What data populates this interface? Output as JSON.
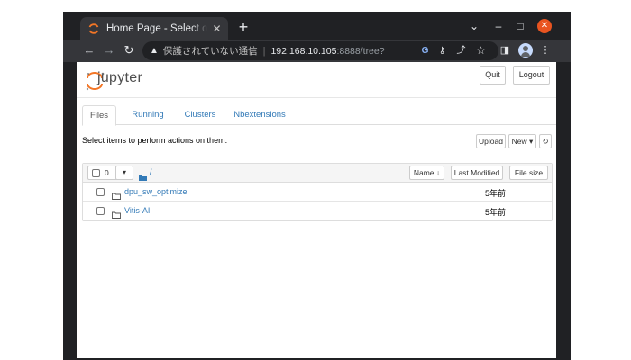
{
  "browser": {
    "tab_title": "Home Page - Select or create a notebook",
    "tab_close": "✕",
    "new_tab": "+",
    "window_controls": {
      "dropdown": "⌄",
      "minimize": "–",
      "maximize": "□",
      "close": "✕"
    },
    "nav": {
      "back": "←",
      "forward": "→",
      "reload": "↻"
    },
    "omnibox": {
      "warning_icon": "▲",
      "insecure_text": "保護されていない通信",
      "separator": "|",
      "url_host": "192.168.10.105",
      "url_rest": ":8888/tree?"
    },
    "icons": {
      "google": "G",
      "key": "⚷",
      "share": "⤴",
      "bookmark": "☆",
      "sidepanel": "◨",
      "menu": "⋮"
    }
  },
  "jupyter": {
    "logo_text": "jupyter",
    "quit_label": "Quit",
    "logout_label": "Logout",
    "tabs": [
      {
        "label": "Files"
      },
      {
        "label": "Running"
      },
      {
        "label": "Clusters"
      },
      {
        "label": "Nbextensions"
      }
    ],
    "instruction": "Select items to perform actions on them.",
    "upload_label": "Upload",
    "new_label": "New ▾",
    "refresh_icon": "↻",
    "list_header": {
      "selected_count": "0",
      "dropdown_caret": "▾",
      "breadcrumb": "/",
      "name_label": "Name ↓",
      "last_modified_label": "Last Modified",
      "file_size_label": "File size"
    },
    "files": [
      {
        "name": "dpu_sw_optimize",
        "modified": "5年前"
      },
      {
        "name": "Vitis-AI",
        "modified": "5年前"
      }
    ]
  },
  "colors": {
    "link": "#337ab7",
    "jupyter_orange": "#f37626",
    "chrome_dark": "#202124",
    "chrome_toolbar": "#35363a"
  }
}
